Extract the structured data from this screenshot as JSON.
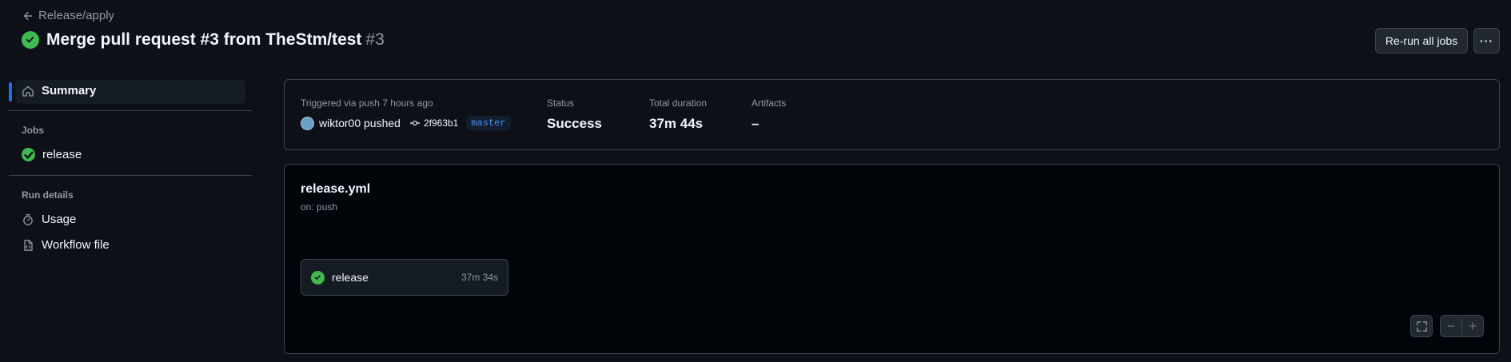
{
  "header": {
    "back_label": "Release/apply",
    "title": "Merge pull request #3 from TheStm/test",
    "run_number": "#3",
    "rerun_label": "Re-run all jobs",
    "more_label": "···"
  },
  "sidebar": {
    "summary_label": "Summary",
    "jobs_heading": "Jobs",
    "jobs": [
      {
        "label": "release",
        "status": "success"
      }
    ],
    "run_details_heading": "Run details",
    "run_details": [
      {
        "label": "Usage",
        "icon": "stopwatch-icon"
      },
      {
        "label": "Workflow file",
        "icon": "file-code-icon"
      }
    ]
  },
  "summary": {
    "trigger_label": "Triggered via push 7 hours ago",
    "actor": "wiktor00 pushed",
    "commit_sha": "2f963b1",
    "branch": "master",
    "status_label": "Status",
    "status_value": "Success",
    "duration_label": "Total duration",
    "duration_value": "37m 44s",
    "artifacts_label": "Artifacts",
    "artifacts_value": "–"
  },
  "workflow": {
    "file": "release.yml",
    "trigger": "on: push",
    "job": {
      "name": "release",
      "duration": "37m 34s"
    },
    "zoom_out": "−",
    "zoom_in": "+"
  },
  "colors": {
    "background": "#0d1117",
    "success": "#3fb950",
    "accent": "#1f6feb",
    "branch": "#4493f8"
  }
}
